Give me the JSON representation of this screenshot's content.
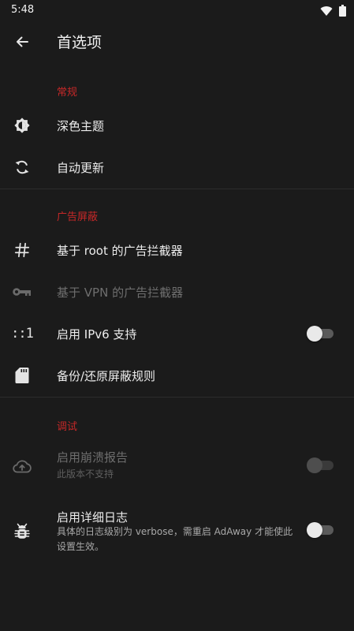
{
  "status_bar": {
    "time": "5:48",
    "icons": [
      "wifi-icon",
      "battery-icon"
    ]
  },
  "app_bar": {
    "back_icon": "arrow-back-icon",
    "title": "首选项"
  },
  "sections": {
    "general": {
      "header": "常规",
      "items": [
        {
          "label": "深色主题",
          "icon": "dark-theme-icon"
        },
        {
          "label": "自动更新",
          "icon": "sync-icon"
        }
      ]
    },
    "ad_blocking": {
      "header": "广告屏蔽",
      "items": [
        {
          "label": "基于 root 的广告拦截器",
          "icon": "hash-icon"
        },
        {
          "label": "基于 VPN 的广告拦截器",
          "icon": "key-icon"
        },
        {
          "label": "启用 IPv6 支持",
          "icon": "ipv6-icon",
          "icon_text": "::1",
          "toggle": "off"
        },
        {
          "label": "备份/还原屏蔽规则",
          "icon": "sd-card-icon"
        }
      ]
    },
    "debug": {
      "header": "调试",
      "items": [
        {
          "label": "启用崩溃报告",
          "summary": "此版本不支持",
          "icon": "cloud-upload-icon",
          "toggle": "off",
          "disabled": true
        },
        {
          "label": "启用详细日志",
          "summary": "具体的日志级别为 verbose，需重启 AdAway 才能使此设置生效。",
          "icon": "bug-icon",
          "toggle": "off"
        }
      ]
    }
  },
  "colors": {
    "background": "#1b1b1b",
    "accent": "#c62828",
    "text_primary": "#ededed",
    "text_disabled": "#6e6e6e"
  }
}
